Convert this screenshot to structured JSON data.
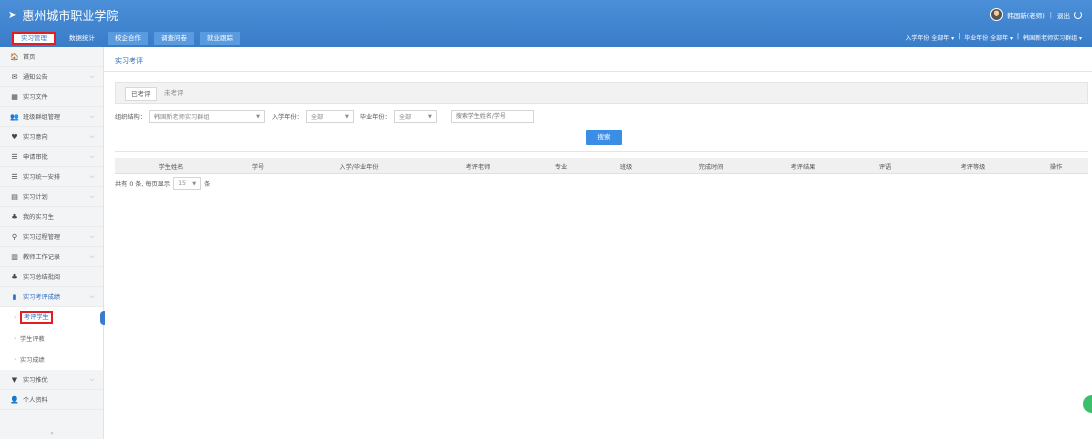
{
  "header": {
    "school_name": "惠州城市职业学院",
    "user_name": "韩国新(老师)",
    "logout": "退出"
  },
  "nav": {
    "tabs": [
      "实习管理",
      "数据统计",
      "校企合作",
      "调查问卷",
      "就业跟踪"
    ],
    "right": {
      "enroll_year": "入学年份  全部年 ▾",
      "grad_year": "毕业年份  全部年 ▾",
      "group": "韩国新老师实习群组 ▾",
      "sep": "|"
    }
  },
  "sidebar": {
    "items": [
      {
        "icon": "home-icon",
        "glyph": "🏠",
        "label": "首页",
        "chev": false
      },
      {
        "icon": "mail-icon",
        "glyph": "✉",
        "label": "通知公告",
        "chev": true
      },
      {
        "icon": "chart-icon",
        "glyph": "▦",
        "label": "实习文件",
        "chev": false
      },
      {
        "icon": "users-icon",
        "glyph": "👥",
        "label": "班级群组管理",
        "chev": true
      },
      {
        "icon": "heart-icon",
        "glyph": "♥",
        "label": "实习意向",
        "chev": true
      },
      {
        "icon": "list-icon",
        "glyph": "☰",
        "label": "申请审批",
        "chev": true
      },
      {
        "icon": "list-icon",
        "glyph": "☰",
        "label": "实习统一安排",
        "chev": true
      },
      {
        "icon": "calendar-icon",
        "glyph": "▤",
        "label": "实习计划",
        "chev": true
      },
      {
        "icon": "org-icon",
        "glyph": "♣",
        "label": "我的实习生",
        "chev": false
      },
      {
        "icon": "pin-icon",
        "glyph": "⚲",
        "label": "实习过程管理",
        "chev": true
      },
      {
        "icon": "notebook-icon",
        "glyph": "▥",
        "label": "教师工作记录",
        "chev": true
      },
      {
        "icon": "org-icon",
        "glyph": "♣",
        "label": "实习总结批阅",
        "chev": false
      }
    ],
    "open_item": {
      "icon": "bookmark-icon",
      "glyph": "▮",
      "label": "实习考评成绩"
    },
    "sub_items": [
      "考评学生",
      "学生评教",
      "实习成绩"
    ],
    "after_items": [
      {
        "icon": "filter-icon",
        "glyph": "▼",
        "label": "实习推优",
        "chev": true
      },
      {
        "icon": "person-icon",
        "glyph": "👤",
        "label": "个人资料",
        "chev": false
      }
    ],
    "chevron": "⌵",
    "collapse": "«"
  },
  "content": {
    "breadcrumb": "实习考评",
    "tabs": [
      "已考评",
      "未考评"
    ],
    "filters": {
      "org_label": "组织结构：",
      "org_value": "韩国新老师实习群组",
      "enroll_label": "入学年份：",
      "enroll_value": "全部",
      "grad_label": "毕业年份：",
      "grad_value": "全部",
      "search_placeholder": "搜索学生姓名/学号"
    },
    "search_button": "搜索",
    "columns": [
      "学生姓名",
      "学号",
      "入学/毕业年份",
      "考评老师",
      "专业",
      "班级",
      "完成时间",
      "考评结果",
      "评语",
      "考评等级",
      "操作"
    ],
    "pager": {
      "prefix": "共有 0 条, 每页显示",
      "page_size": "15",
      "suffix": "条"
    }
  },
  "colors": {
    "header_blue": "#3a7cc8",
    "highlight_red": "#e02020",
    "button_blue": "#3a8ee6"
  }
}
